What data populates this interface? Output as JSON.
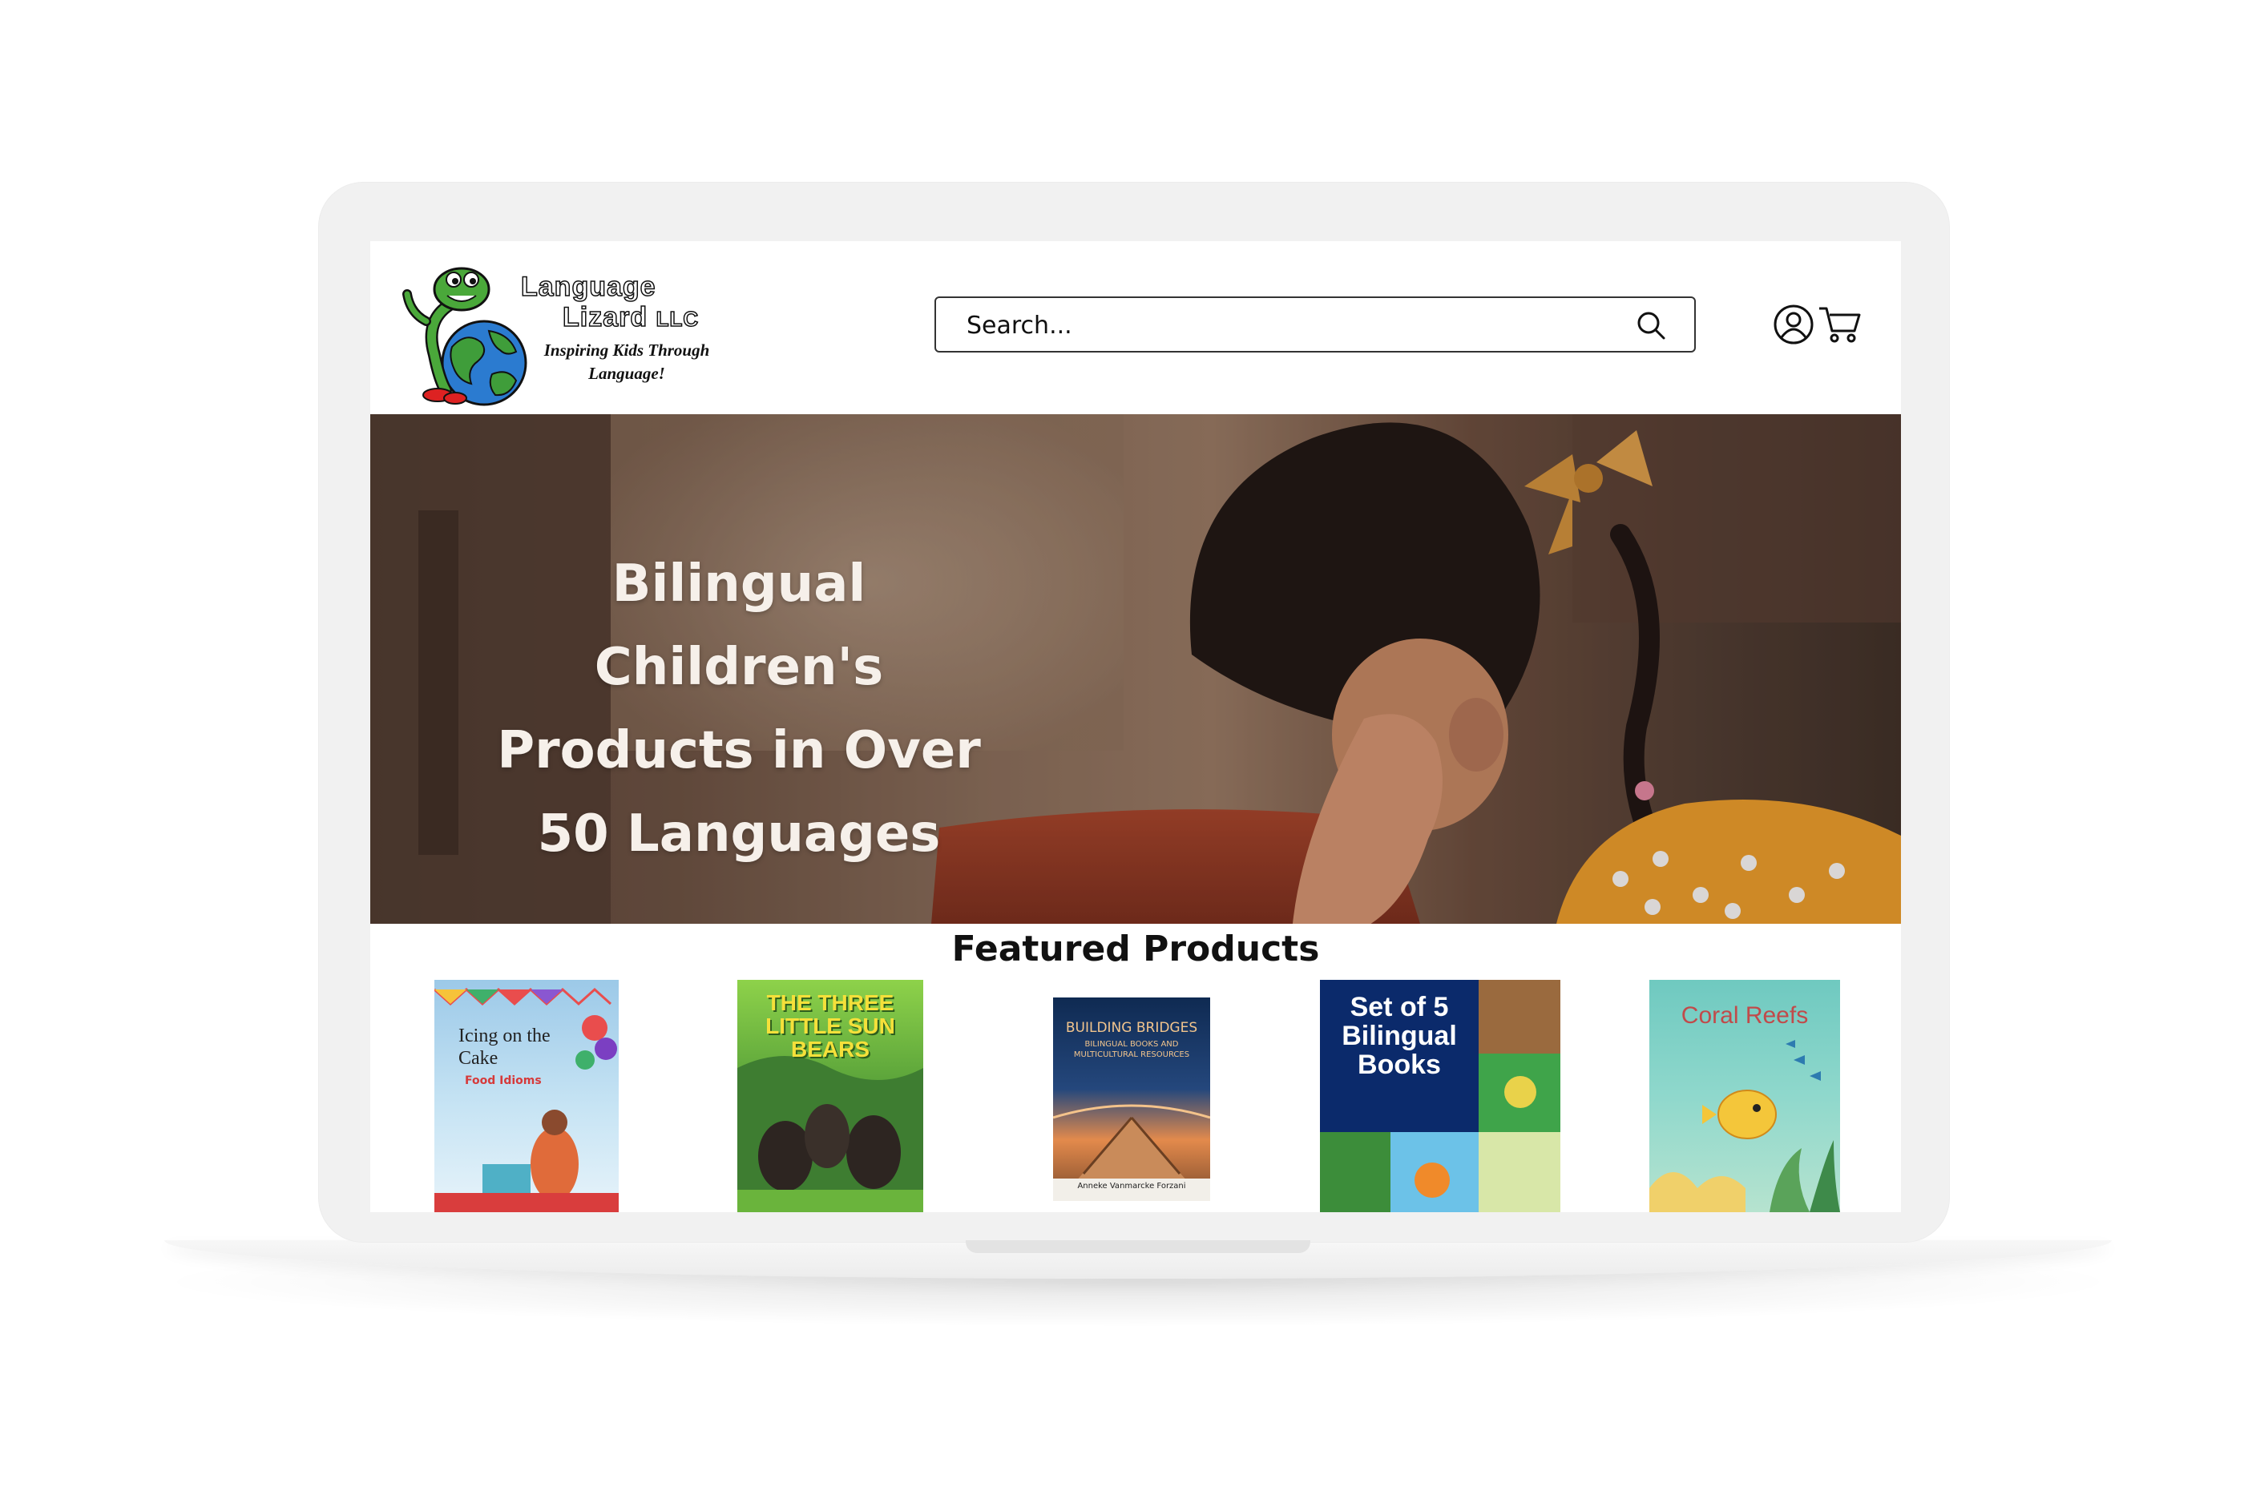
{
  "header": {
    "logo": {
      "line1": "Language",
      "line2": "Lizard",
      "suffix": "LLC",
      "tagline": "Inspiring Kids Through Language!"
    },
    "search": {
      "placeholder": "Search..."
    },
    "icons": {
      "account": "user-circle-icon",
      "cart": "shopping-cart-icon"
    }
  },
  "hero": {
    "heading": "Bilingual Children's Products in Over 50 Languages"
  },
  "featured": {
    "title": "Featured Products",
    "products": [
      {
        "title": "Icing on the Cake",
        "subtitle": "Food Idioms"
      },
      {
        "title": "THE THREE LITTLE SUN BEARS"
      },
      {
        "title": "BUILDING BRIDGES",
        "subtitle": "BILINGUAL BOOKS AND MULTICULTURAL RESOURCES",
        "author": "Anneke Vanmarcke Forzani"
      },
      {
        "title": "Set of 5 Bilingual Books"
      },
      {
        "title": "Coral Reefs"
      }
    ]
  },
  "colors": {
    "lizard_green": "#4aa83a",
    "text_dark": "#111111",
    "hero_text": "#f6f0ea"
  }
}
